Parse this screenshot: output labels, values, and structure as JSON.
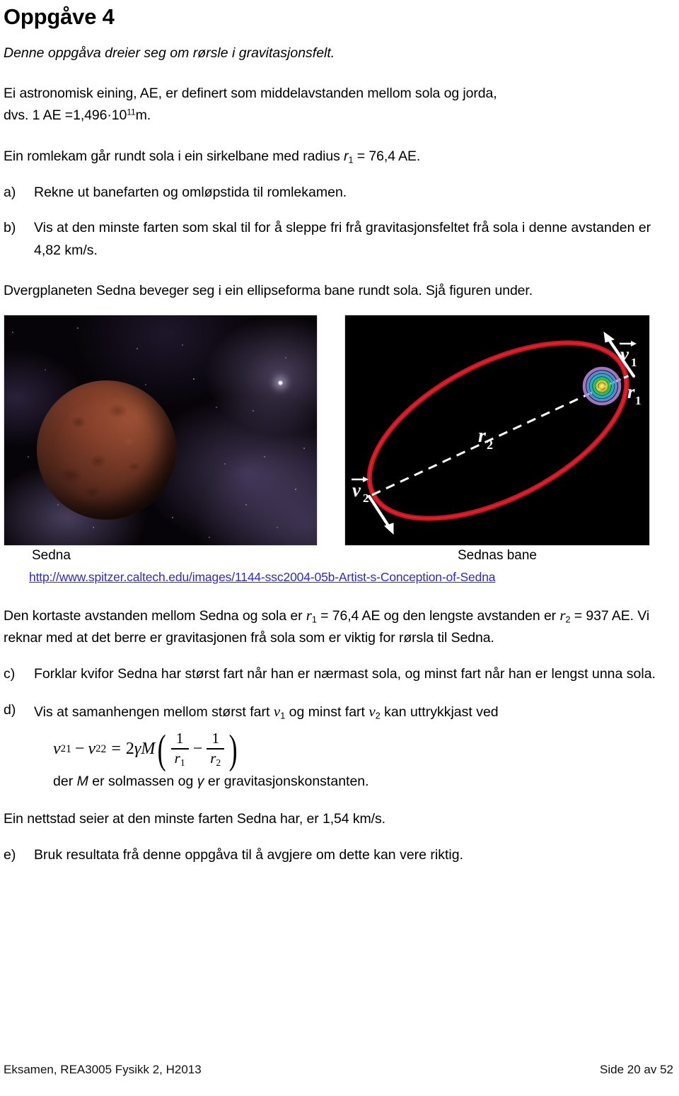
{
  "document": {
    "heading": "Oppgåve 4",
    "intro_italic": "Denne oppgåva dreier seg om rørsle i gravitasjonsfelt.",
    "paragraph_ae_line1": "Ei astronomisk eining, AE, er definert som middelavstanden mellom sola og jorda,",
    "paragraph_ae_line2_prefix": "dvs.  1 AE =1,496",
    "paragraph_ae_dot": "·",
    "paragraph_ae_base": "10",
    "paragraph_ae_exponent": "11",
    "paragraph_ae_unit": "m.",
    "paragraph_spacecraft_pre": "Ein romlekam går rundt sola i ein sirkelbane med radius ",
    "paragraph_spacecraft_var": "r",
    "paragraph_spacecraft_sub": "1",
    "paragraph_spacecraft_post": " = 76,4 AE.",
    "paragraph_sedna_orbit": "Dvergplaneten Sedna beveger seg i ein ellipseforma bane rundt sola. Sjå figuren under.",
    "paragraph_distances_pre": "Den kortaste avstanden mellom Sedna og sola er ",
    "paragraph_distances_r1_var": "r",
    "paragraph_distances_r1_sub": "1",
    "paragraph_distances_r1_val": " = 76,4 AE",
    "paragraph_distances_mid": " og den lengste avstanden er ",
    "paragraph_distances_r2_var": "r",
    "paragraph_distances_r2_sub": "2",
    "paragraph_distances_r2_val": " = 937 AE",
    "paragraph_distances_post": ". Vi reknar med at det berre er gravitasjonen frå sola som er viktig for rørsla til Sedna.",
    "paragraph_website_claim": "Ein nettstad seier at den minste farten Sedna har, er 1,54 km/s."
  },
  "tasks": [
    {
      "marker": "a)",
      "text": "Rekne ut banefarten og omløpstida til romlekamen."
    },
    {
      "marker": "b)",
      "text": "Vis at den minste farten som skal til for å sleppe fri frå gravitasjonsfeltet frå sola i denne avstanden er 4,82 km/s."
    },
    {
      "marker": "c)",
      "text": "Forklar kvifor Sedna har størst fart når han er nærmast sola, og minst fart når han er lengst unna sola."
    },
    {
      "marker": "d)",
      "text_pre": "Vis at samanhengen mellom størst fart ",
      "v1_var": "v",
      "v1_sub": "1",
      "text_mid": " og minst fart ",
      "v2_var": "v",
      "v2_sub": "2",
      "text_post": " kan uttrykkjast ved"
    },
    {
      "marker": "e)",
      "text": "Bruk resultata frå denne oppgåva til å avgjere om dette kan vere riktig."
    }
  ],
  "formula": {
    "v": "v",
    "one": "1",
    "two": "2",
    "sq": "2",
    "minus": "−",
    "equals": "=",
    "coefficient": "2",
    "gamma": "γ",
    "mass": "M",
    "paren_open": "(",
    "paren_close": ")",
    "numerator": "1",
    "denominator_r": "r",
    "caption": "der M er solmassen og γ er gravitasjonskonstanten.",
    "caption_pre": "der ",
    "caption_M": "M",
    "caption_mid": " er solmassen og ",
    "caption_gamma": "γ",
    "caption_post": " er gravitasjonskonstanten."
  },
  "figures": {
    "left": {
      "caption": "Sedna",
      "alt": "artist-conception-of-sedna"
    },
    "right": {
      "caption": "Sednas bane",
      "alt": "sedna-elliptical-orbit-diagram",
      "labels": {
        "v1": "v",
        "v1_sub": "1",
        "v2": "v",
        "v2_sub": "2",
        "r1": "r",
        "r1_sub": "1",
        "r2": "r",
        "r2_sub": "2"
      },
      "orbit_color": "#cc1420",
      "guide_color": "#ffffff",
      "background_color": "#000000"
    },
    "source_url": "http://www.spitzer.caltech.edu/images/1144-ssc2004-05b-Artist-s-Conception-of-Sedna"
  },
  "footer": {
    "left": "Eksamen, REA3005 Fysikk 2, H2013",
    "right": "Side 20 av 52"
  }
}
